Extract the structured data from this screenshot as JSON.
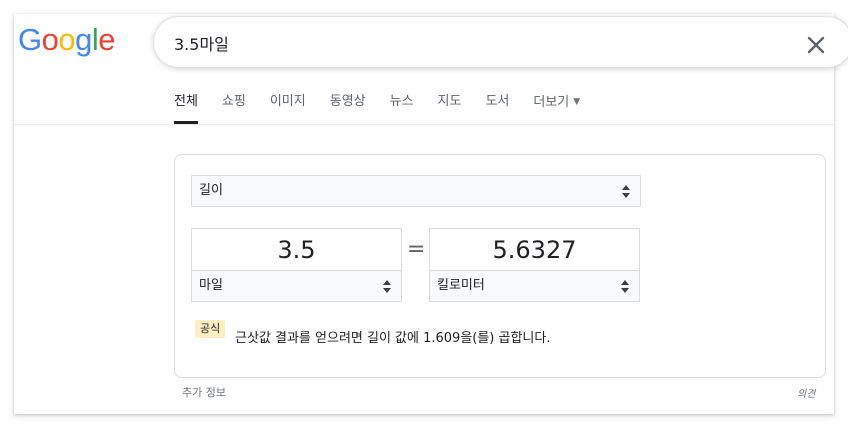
{
  "logo": {
    "letters": [
      "G",
      "o",
      "o",
      "g",
      "l",
      "e"
    ],
    "colors": [
      "#4285F4",
      "#EA4335",
      "#FBBC05",
      "#4285F4",
      "#34A853",
      "#EA4335"
    ]
  },
  "search": {
    "value": "3.5마일",
    "clear_icon": "close-icon"
  },
  "tabs": [
    {
      "label": "전체",
      "active": true
    },
    {
      "label": "쇼핑"
    },
    {
      "label": "이미지"
    },
    {
      "label": "동영상"
    },
    {
      "label": "뉴스"
    },
    {
      "label": "지도"
    },
    {
      "label": "도서"
    },
    {
      "label": "더보기",
      "has_caret": true
    }
  ],
  "converter": {
    "category": "길이",
    "from": {
      "value": "3.5",
      "unit": "마일"
    },
    "equals": "=",
    "to": {
      "value": "5.6327",
      "unit": "킬로미터"
    },
    "formula_badge": "공식",
    "formula_text": "근삿값 결과를 얻으려면 길이 값에 1.609을(를) 곱합니다."
  },
  "footer": {
    "more_info": "추가 정보",
    "feedback": "의견"
  }
}
